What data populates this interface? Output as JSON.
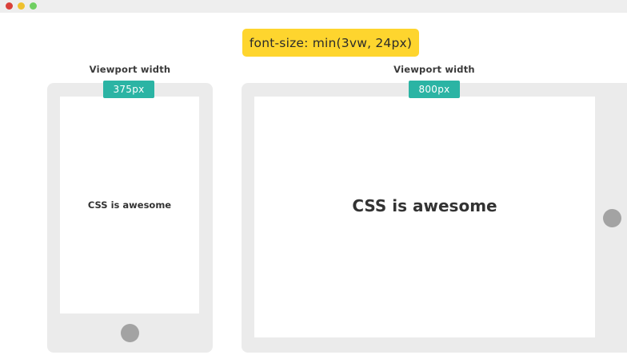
{
  "window": {
    "controls": [
      "close-dot",
      "minimize-dot",
      "maximize-dot"
    ],
    "colors": {
      "close": "#d9403a",
      "minimize": "#efc12f",
      "maximize": "#6fcf61"
    }
  },
  "formula": {
    "text": "font-size: min(3vw, 24px)",
    "color": "#fed52e"
  },
  "accent_color": "#2bb4a4",
  "phone": {
    "label": "Viewport width",
    "width_badge": "375px",
    "screen_text": "CSS is awesome"
  },
  "tablet": {
    "label": "Viewport width",
    "width_badge": "800px",
    "screen_text": "CSS is awesome"
  }
}
